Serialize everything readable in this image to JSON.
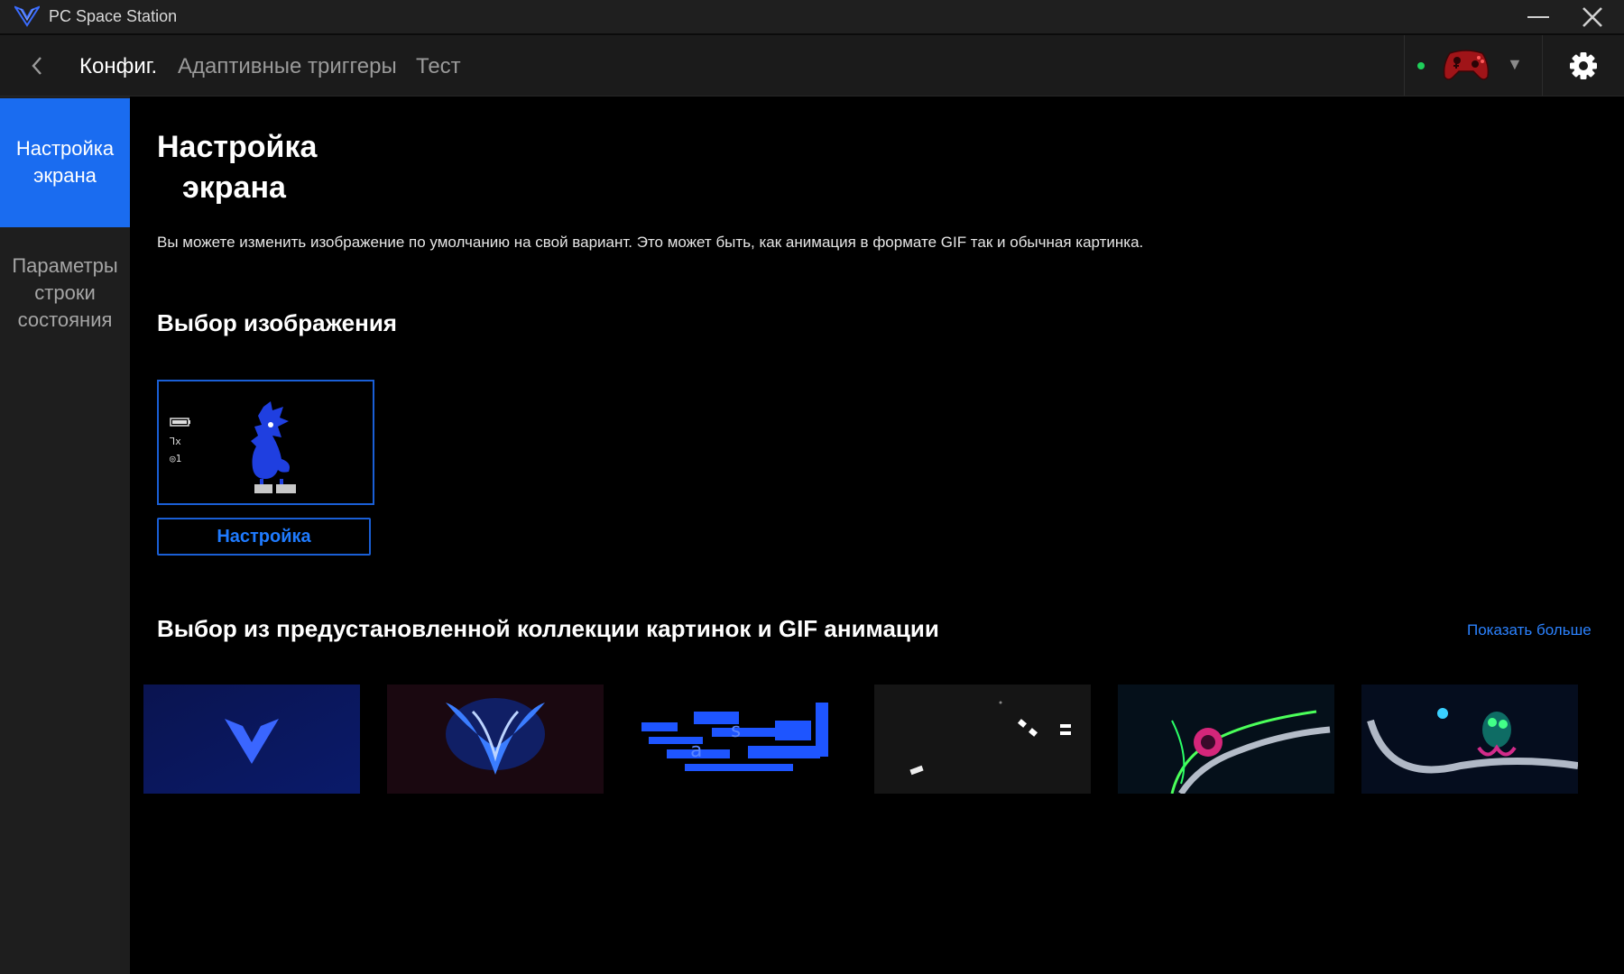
{
  "window": {
    "title": "PC Space Station"
  },
  "nav": {
    "tabs": [
      {
        "label": "Конфиг.",
        "active": true
      },
      {
        "label": "Адаптивные триггеры",
        "active": false
      },
      {
        "label": "Тест",
        "active": false
      }
    ],
    "device": {
      "status": "connected",
      "status_color": "#1fcf5a"
    }
  },
  "sidebar": {
    "items": [
      {
        "label": "Настройка экрана",
        "active": true
      },
      {
        "label": "Параметры строки состояния",
        "active": false
      }
    ]
  },
  "main": {
    "title_line1": "Настройка",
    "title_line2": "экрана",
    "description": "Вы можете изменить изображение по умолчанию на свой вариант. Это может быть, как анимация в формате GIF так и обычная картинка.",
    "image_section_title": "Выбор изображения",
    "preview_status": {
      "slot": "x",
      "profile": "1"
    },
    "config_button": "Настройка",
    "collection_title": "Выбор из предустановленной коллекции картинок и GIF анимации",
    "show_more": "Показать больше",
    "thumbnails": [
      {
        "name": "blue-logo"
      },
      {
        "name": "blue-flame-logo"
      },
      {
        "name": "glitch-text"
      },
      {
        "name": "dark-particles"
      },
      {
        "name": "neon-green-tentacle"
      },
      {
        "name": "neon-octopus"
      }
    ]
  },
  "colors": {
    "accent": "#1a6cf0",
    "link": "#2b82ff",
    "sidebar_bg": "#1e1e1e"
  }
}
